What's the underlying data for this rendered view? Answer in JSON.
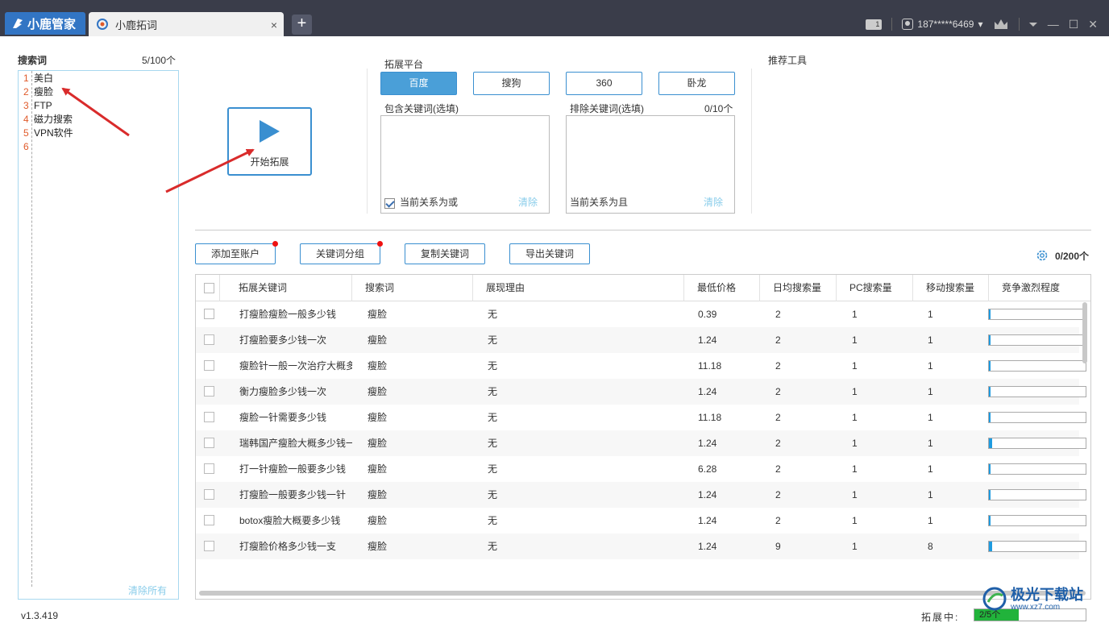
{
  "titlebar": {
    "brand": "小鹿管家",
    "tab_title": "小鹿拓词",
    "tab_close": "×",
    "tab_add": "+",
    "badge": "1",
    "user": "187*****6469",
    "user_caret": "▾",
    "min": "—",
    "max": "☐",
    "close": "✕",
    "menu": "⏷"
  },
  "left": {
    "label": "搜索词",
    "count": "5/100个",
    "lines": [
      {
        "num": "1",
        "text": "美白"
      },
      {
        "num": "2",
        "text": "瘦脸"
      },
      {
        "num": "3",
        "text": "FTP"
      },
      {
        "num": "4",
        "text": "磁力搜索"
      },
      {
        "num": "5",
        "text": "VPN软件"
      },
      {
        "num": "6",
        "text": ""
      }
    ],
    "clear_all": "清除所有"
  },
  "start": {
    "label": "开始拓展"
  },
  "platform": {
    "label": "拓展平台",
    "buttons": [
      "百度",
      "搜狗",
      "360",
      "卧龙"
    ],
    "active_index": 0
  },
  "include": {
    "label": "包含关键词(选填)",
    "relation": "当前关系为或",
    "checked": true,
    "clear": "清除"
  },
  "exclude": {
    "label": "排除关键词(选填)",
    "count": "0/10个",
    "relation": "当前关系为且",
    "clear": "清除"
  },
  "recommend": {
    "label": "推荐工具"
  },
  "actions": {
    "add_account": "添加至账户",
    "group": "关键词分组",
    "copy": "复制关键词",
    "export": "导出关键词",
    "selected_count": "0/200个"
  },
  "table": {
    "headers": [
      "拓展关键词",
      "搜索词",
      "展现理由",
      "最低价格",
      "日均搜索量",
      "PC搜索量",
      "移动搜索量",
      "竞争激烈程度"
    ],
    "rows": [
      {
        "kw": "打瘦脸瘦脸一般多少钱",
        "src": "瘦脸",
        "reason": "无",
        "price": "0.39",
        "daily": "2",
        "pc": "1",
        "mobile": "1",
        "comp": 0.01
      },
      {
        "kw": "打瘦脸要多少钱一次",
        "src": "瘦脸",
        "reason": "无",
        "price": "1.24",
        "daily": "2",
        "pc": "1",
        "mobile": "1",
        "comp": 0.01
      },
      {
        "kw": "瘦脸针一般一次治疗大概多少钱",
        "src": "瘦脸",
        "reason": "无",
        "price": "11.18",
        "daily": "2",
        "pc": "1",
        "mobile": "1",
        "comp": 0.01
      },
      {
        "kw": "衡力瘦脸多少钱一次",
        "src": "瘦脸",
        "reason": "无",
        "price": "1.24",
        "daily": "2",
        "pc": "1",
        "mobile": "1",
        "comp": 0.01
      },
      {
        "kw": "瘦脸一针需要多少钱",
        "src": "瘦脸",
        "reason": "无",
        "price": "11.18",
        "daily": "2",
        "pc": "1",
        "mobile": "1",
        "comp": 0.01
      },
      {
        "kw": "瑞韩国产瘦脸大概多少钱一针",
        "src": "瘦脸",
        "reason": "无",
        "price": "1.24",
        "daily": "2",
        "pc": "1",
        "mobile": "1",
        "comp": 0.03
      },
      {
        "kw": "打一针瘦脸一般要多少钱",
        "src": "瘦脸",
        "reason": "无",
        "price": "6.28",
        "daily": "2",
        "pc": "1",
        "mobile": "1",
        "comp": 0.01
      },
      {
        "kw": "打瘦脸一般要多少钱一针",
        "src": "瘦脸",
        "reason": "无",
        "price": "1.24",
        "daily": "2",
        "pc": "1",
        "mobile": "1",
        "comp": 0.02
      },
      {
        "kw": "botox瘦脸大概要多少钱",
        "src": "瘦脸",
        "reason": "无",
        "price": "1.24",
        "daily": "2",
        "pc": "1",
        "mobile": "1",
        "comp": 0.01
      },
      {
        "kw": "打瘦脸价格多少钱一支",
        "src": "瘦脸",
        "reason": "无",
        "price": "1.24",
        "daily": "9",
        "pc": "1",
        "mobile": "8",
        "comp": 0.03
      }
    ]
  },
  "footer": {
    "version": "v1.3.419",
    "progress_label": "拓展中:",
    "progress_text": "2/5个",
    "progress_value": 0.4
  },
  "watermark": {
    "name": "极光下载站",
    "url": "www.xz7.com"
  },
  "colors": {
    "accent": "#3a8fd0",
    "active_platform": "#4a9fd8",
    "titlebar": "#3a3d4a",
    "brand": "#3275c4",
    "annotation_arrow": "#d92b2b",
    "progress": "#21b33b",
    "competition": "#1e9be0"
  }
}
